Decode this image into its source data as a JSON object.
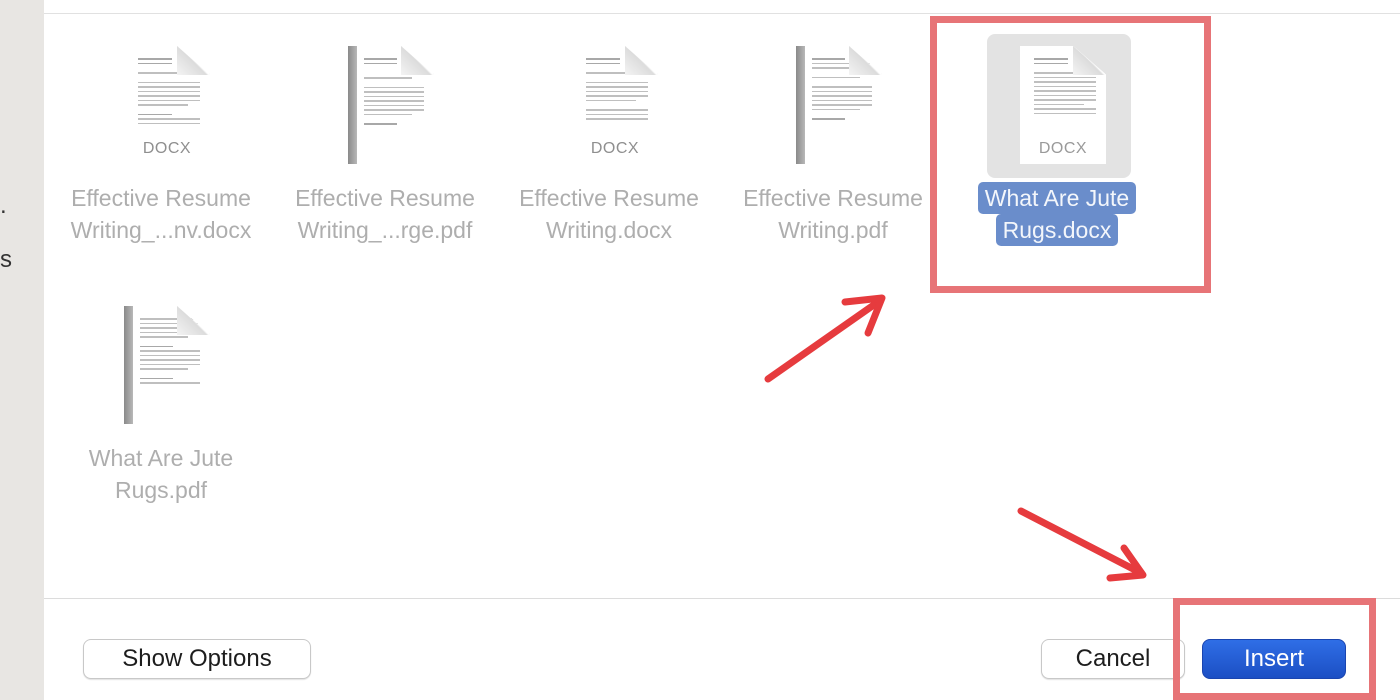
{
  "files": [
    {
      "name_line1": "Effective Resume",
      "name_line2": "Writing_...nv.docx",
      "type": "docx",
      "badge": "DOCX",
      "selected": false
    },
    {
      "name_line1": "Effective Resume",
      "name_line2": "Writing_...rge.pdf",
      "type": "pdf",
      "badge": "",
      "selected": false
    },
    {
      "name_line1": "Effective Resume",
      "name_line2": "Writing.docx",
      "type": "docx",
      "badge": "DOCX",
      "selected": false
    },
    {
      "name_line1": "Effective Resume",
      "name_line2": "Writing.pdf",
      "type": "pdf",
      "badge": "",
      "selected": false
    },
    {
      "name_line1": "What Are Jute",
      "name_line2": "Rugs.docx",
      "type": "docx",
      "badge": "DOCX",
      "selected": true
    },
    {
      "name_line1": "What Are Jute",
      "name_line2": "Rugs.pdf",
      "type": "pdf",
      "badge": "",
      "selected": false
    }
  ],
  "footer": {
    "show_options_label": "Show Options",
    "cancel_label": "Cancel",
    "insert_label": "Insert"
  },
  "colors": {
    "selection": "#6a8dcb",
    "primary_button": "#1c4fc4",
    "annotation": "#e77477",
    "arrow": "#e63b3e"
  },
  "background_marks": [
    ".",
    "s"
  ]
}
